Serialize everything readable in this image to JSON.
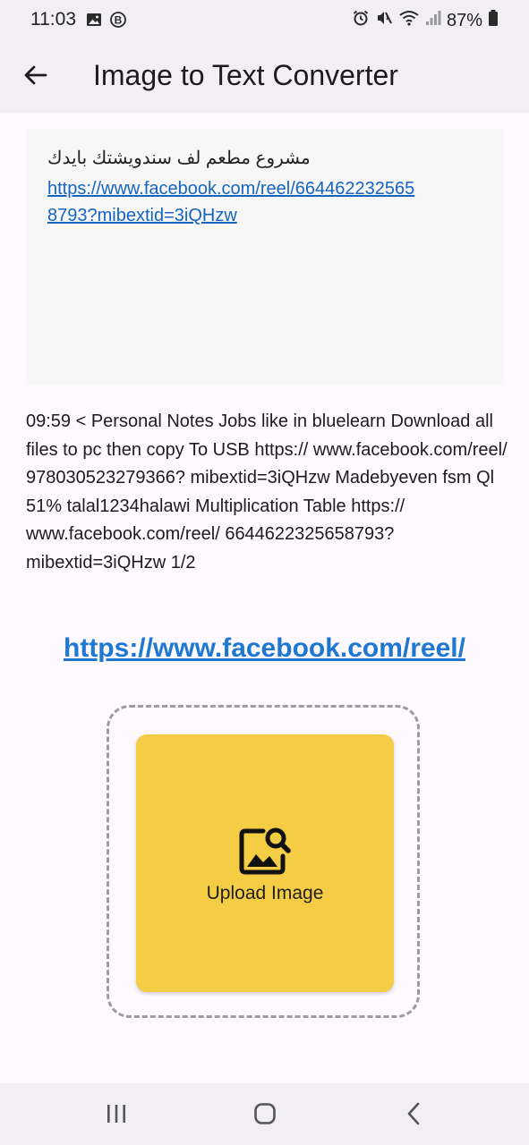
{
  "status_bar": {
    "time": "11:03",
    "battery": "87%",
    "icons": [
      "image-icon",
      "b-badge-icon",
      "alarm-icon",
      "mute-icon",
      "wifi-icon",
      "signal-icon",
      "battery-icon"
    ]
  },
  "app_bar": {
    "back_icon": "arrow-back-icon",
    "title": "Image to Text Converter"
  },
  "preview": {
    "arabic_text": "مشروع مطعم لف سندويشتك بايدك",
    "link_text": "https://www.facebook.com/reel/6644622325658793?mibextid=3iQHzw"
  },
  "extracted_text": "09:59 < Personal Notes Jobs like in bluelearn Download all files to pc then copy To USB https:// www.facebook.com/reel/ 978030523279366? mibextid=3iQHzw Madebyeven fsm Ql 51% talal1234halawi Multiplication Table https:// www.facebook.com/reel/ 6644622325658793? mibextid=3iQHzw 1/2",
  "detected_link": "https://www.facebook.com/reel/",
  "upload": {
    "icon": "image-search-icon",
    "label": "Upload Image"
  },
  "nav_bar": {
    "recents_icon": "recents-icon",
    "home_icon": "home-icon",
    "back_icon": "nav-back-icon"
  },
  "colors": {
    "upload_card": "#f5cd45",
    "link": "#1e78d2",
    "bar_background": "#f1eef4"
  }
}
